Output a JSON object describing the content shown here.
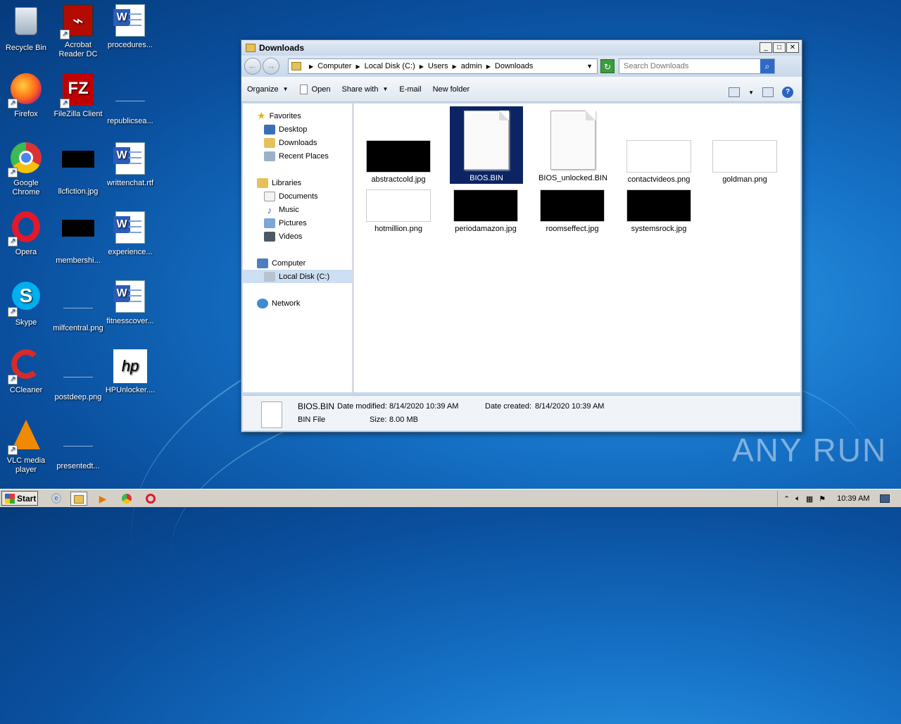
{
  "desktop": {
    "icons": [
      {
        "label": "Recycle Bin"
      },
      {
        "label": "Acrobat Reader DC"
      },
      {
        "label": "procedures..."
      },
      {
        "label": "Firefox"
      },
      {
        "label": "FileZilla Client"
      },
      {
        "label": "republicsea..."
      },
      {
        "label": "Google Chrome"
      },
      {
        "label": "llcfiction.jpg"
      },
      {
        "label": "writtenchat.rtf"
      },
      {
        "label": "Opera"
      },
      {
        "label": "membershi..."
      },
      {
        "label": "experience..."
      },
      {
        "label": "Skype"
      },
      {
        "label": "milfcentral.png"
      },
      {
        "label": "fitnesscover..."
      },
      {
        "label": "CCleaner"
      },
      {
        "label": "postdeep.png"
      },
      {
        "label": "HPUnlocker...."
      },
      {
        "label": "VLC media player"
      },
      {
        "label": "presentedt..."
      }
    ],
    "watermark": "ANY RUN"
  },
  "window": {
    "title": "Downloads",
    "controls": {
      "minimize": "_",
      "maximize": "□",
      "close": "✕"
    },
    "breadcrumb": [
      "Computer",
      "Local Disk (C:)",
      "Users",
      "admin",
      "Downloads"
    ],
    "search_placeholder": "Search Downloads",
    "toolbar": {
      "organize": "Organize",
      "open": "Open",
      "share_with": "Share with",
      "email": "E-mail",
      "new_folder": "New folder"
    },
    "nav": {
      "favorites": "Favorites",
      "desktop": "Desktop",
      "downloads": "Downloads",
      "recent": "Recent Places",
      "libraries": "Libraries",
      "documents": "Documents",
      "music": "Music",
      "pictures": "Pictures",
      "videos": "Videos",
      "computer": "Computer",
      "local_disk": "Local Disk (C:)",
      "network": "Network"
    },
    "files": [
      {
        "name": "abstractcold.jpg"
      },
      {
        "name": "BIOS.BIN"
      },
      {
        "name": "BIOS_unlocked.BIN"
      },
      {
        "name": "contactvideos.png"
      },
      {
        "name": "goldman.png"
      },
      {
        "name": "hotmillion.png"
      },
      {
        "name": "periodamazon.jpg"
      },
      {
        "name": "roomseffect.jpg"
      },
      {
        "name": "systemsrock.jpg"
      }
    ],
    "details": {
      "name": "BIOS.BIN",
      "type": "BIN File",
      "modified_label": "Date modified:",
      "modified_value": "8/14/2020 10:39 AM",
      "created_label": "Date created:",
      "created_value": "8/14/2020 10:39 AM",
      "size_label": "Size:",
      "size_value": "8.00 MB"
    }
  },
  "taskbar": {
    "start": "Start",
    "clock": "10:39 AM"
  }
}
